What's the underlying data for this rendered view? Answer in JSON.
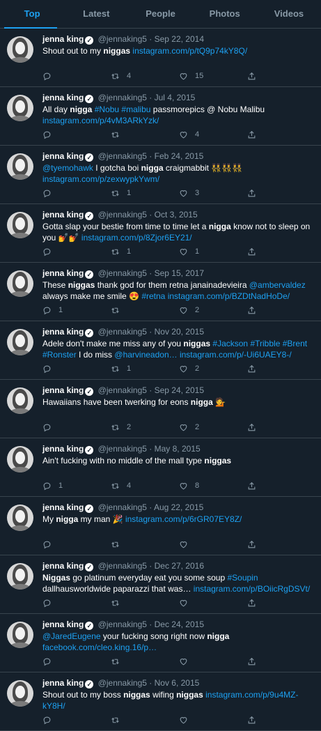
{
  "tabs": [
    {
      "label": "Top",
      "active": true
    },
    {
      "label": "Latest"
    },
    {
      "label": "People"
    },
    {
      "label": "Photos"
    },
    {
      "label": "Videos"
    }
  ],
  "tweets": [
    {
      "name": "jenna king",
      "handle": "@jennaking5",
      "date": "Sep 22, 2014",
      "body": [
        {
          "t": "Shout out to my "
        },
        {
          "t": "niggas",
          "b": true
        },
        {
          "t": " "
        },
        {
          "t": "instagram.com/p/tQ9p74kY8Q/",
          "l": true
        }
      ],
      "replies": "",
      "retweets": "4",
      "likes": "15"
    },
    {
      "name": "jenna king",
      "handle": "@jennaking5",
      "date": "Jul 4, 2015",
      "body": [
        {
          "t": "All day "
        },
        {
          "t": "nigga",
          "b": true
        },
        {
          "t": " "
        },
        {
          "t": "#Nobu",
          "l": true
        },
        {
          "t": " "
        },
        {
          "t": "#malibu",
          "l": true
        },
        {
          "t": " passmorepics @ Nobu Malibu "
        },
        {
          "t": "instagram.com/p/4vM3ARkYzk/",
          "l": true
        }
      ],
      "replies": "",
      "retweets": "",
      "likes": "4"
    },
    {
      "name": "jenna king",
      "handle": "@jennaking5",
      "date": "Feb 24, 2015",
      "body": [
        {
          "t": "@tyemohawk",
          "l": true
        },
        {
          "t": " I gotcha boi "
        },
        {
          "t": "nigga",
          "b": true
        },
        {
          "t": " craigmabbit 👯👯👯 "
        },
        {
          "t": "instagram.com/p/zexwypkYwm/",
          "l": true
        }
      ],
      "replies": "",
      "retweets": "1",
      "likes": "3"
    },
    {
      "name": "jenna king",
      "handle": "@jennaking5",
      "date": "Oct 3, 2015",
      "body": [
        {
          "t": "Gotta slap your bestie from time to time let a "
        },
        {
          "t": "nigga",
          "b": true
        },
        {
          "t": " know not to sleep on you 💅💅 "
        },
        {
          "t": "instagram.com/p/8Zjor6EY21/",
          "l": true
        }
      ],
      "replies": "",
      "retweets": "1",
      "likes": "1"
    },
    {
      "name": "jenna king",
      "handle": "@jennaking5",
      "date": "Sep 15, 2017",
      "body": [
        {
          "t": "These "
        },
        {
          "t": "niggas",
          "b": true
        },
        {
          "t": " thank god for them retna janainadevieira "
        },
        {
          "t": "@ambervaldez",
          "l": true
        },
        {
          "t": " always make me smile 😍 "
        },
        {
          "t": "#retna",
          "l": true
        },
        {
          "t": " "
        },
        {
          "t": "instagram.com/p/BZDtNadHoDe/",
          "l": true
        }
      ],
      "replies": "1",
      "retweets": "",
      "likes": "2"
    },
    {
      "name": "jenna king",
      "handle": "@jennaking5",
      "date": "Nov 20, 2015",
      "body": [
        {
          "t": "Adele don't make me miss any of you "
        },
        {
          "t": "niggas",
          "b": true
        },
        {
          "t": " "
        },
        {
          "t": "#Jackson",
          "l": true
        },
        {
          "t": " "
        },
        {
          "t": "#Tribble",
          "l": true
        },
        {
          "t": " "
        },
        {
          "t": "#Brent",
          "l": true
        },
        {
          "t": " "
        },
        {
          "t": "#Ronster",
          "l": true
        },
        {
          "t": " I do miss "
        },
        {
          "t": "@harvineadon…",
          "l": true
        },
        {
          "t": " "
        },
        {
          "t": "instagram.com/p/-Ui6UAEY8-/",
          "l": true
        }
      ],
      "replies": "",
      "retweets": "1",
      "likes": "2"
    },
    {
      "name": "jenna king",
      "handle": "@jennaking5",
      "date": "Sep 24, 2015",
      "body": [
        {
          "t": "Hawaiians have been twerking for eons "
        },
        {
          "t": "nigga",
          "b": true
        },
        {
          "t": " 💁"
        }
      ],
      "replies": "",
      "retweets": "2",
      "likes": "2"
    },
    {
      "name": "jenna king",
      "handle": "@jennaking5",
      "date": "May 8, 2015",
      "body": [
        {
          "t": "Ain't fucking with no middle of the mall type "
        },
        {
          "t": "niggas",
          "b": true
        }
      ],
      "replies": "1",
      "retweets": "4",
      "likes": "8"
    },
    {
      "name": "jenna king",
      "handle": "@jennaking5",
      "date": "Aug 22, 2015",
      "body": [
        {
          "t": "My "
        },
        {
          "t": "nigga",
          "b": true
        },
        {
          "t": " my man 🎉 "
        },
        {
          "t": "instagram.com/p/6rGR07EY8Z/",
          "l": true
        }
      ],
      "replies": "",
      "retweets": "",
      "likes": ""
    },
    {
      "name": "jenna king",
      "handle": "@jennaking5",
      "date": "Dec 27, 2016",
      "body": [
        {
          "t": "Niggas",
          "b": true
        },
        {
          "t": " go platinum everyday eat you some soup "
        },
        {
          "t": "#Soupin",
          "l": true
        },
        {
          "t": " dallhausworldwide paparazzi that was… "
        },
        {
          "t": "instagram.com/p/BOiicRgDSVt/",
          "l": true
        }
      ],
      "replies": "",
      "retweets": "",
      "likes": ""
    },
    {
      "name": "jenna king",
      "handle": "@jennaking5",
      "date": "Dec 24, 2015",
      "body": [
        {
          "t": "@JaredEugene",
          "l": true
        },
        {
          "t": " your fucking song right now "
        },
        {
          "t": "nigga",
          "b": true
        },
        {
          "t": " "
        },
        {
          "t": "facebook.com/cleo.king.16/p…",
          "l": true
        }
      ],
      "replies": "",
      "retweets": "",
      "likes": ""
    },
    {
      "name": "jenna king",
      "handle": "@jennaking5",
      "date": "Nov 6, 2015",
      "body": [
        {
          "t": "Shout out to my boss "
        },
        {
          "t": "niggas",
          "b": true
        },
        {
          "t": " wifing "
        },
        {
          "t": "niggas",
          "b": true
        },
        {
          "t": " "
        },
        {
          "t": "instagram.com/p/9u4MZ-kY8H/",
          "l": true
        }
      ],
      "replies": "",
      "retweets": "",
      "likes": ""
    }
  ],
  "colors": {
    "background": "#15202b",
    "accent": "#1da1f2",
    "muted": "#8899a6",
    "divider": "#38444d"
  },
  "icons": {
    "verified": "verified-badge-icon",
    "reply": "reply-icon",
    "retweet": "retweet-icon",
    "like": "heart-icon",
    "share": "share-icon"
  }
}
